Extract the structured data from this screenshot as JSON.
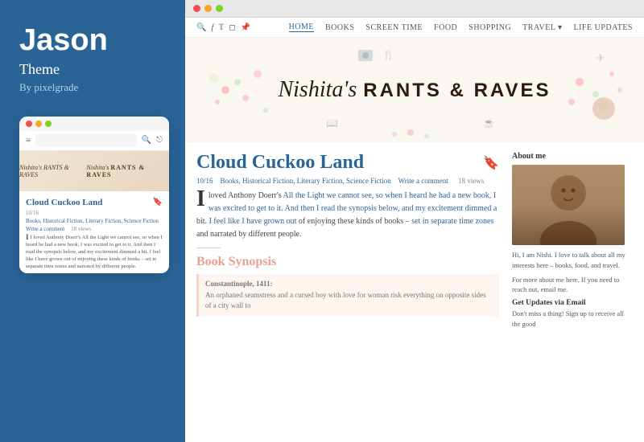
{
  "sidebar": {
    "theme_name": "Jason",
    "theme_label": "Theme",
    "by_label": "By pixelgrade",
    "dots": [
      "red",
      "yellow",
      "green"
    ],
    "mobile": {
      "toolbar_icons": [
        "≡",
        "🔍",
        "⎋"
      ],
      "blog_title": "Nishita's RANTS & RAVES",
      "article_title": "Cloud Cuckoo Land",
      "bookmark": "🔖",
      "meta": "10/16",
      "categories": "Books, Historical Fiction, Literary Fiction, Science Fiction",
      "write_comment": "Write a comment",
      "views": "18 views",
      "body_text": "I loved Anthony Doerr's All the Light we cannot see, so when I heard he had a new book, I was excited to get to it. And then I read the synopsis below, and my excitement dimmed a bit. I feel like I have grown out of enjoying these kinds of books – set in separate time zones and narrated by different people."
    }
  },
  "browser": {
    "dots": [
      "red",
      "yellow",
      "green"
    ],
    "nav": {
      "icons": [
        "🔍",
        "f",
        "𝕋",
        "📷",
        "📌"
      ],
      "links": [
        "HOME",
        "BOOKS",
        "SCREEN TIME",
        "FOOD",
        "SHOPPING",
        "TRAVEL",
        "LIFE UPDATES"
      ],
      "active": "HOME"
    },
    "blog_title_italic": "Nishita's",
    "blog_title_bold": "RANTS & RAVES",
    "article": {
      "title": "Cloud Cuckoo Land",
      "bookmark_icon": "🔖",
      "meta_date": "10/16",
      "meta_categories": "Books, Historical Fiction, Literary Fiction, Science Fiction",
      "meta_write_comment": "Write a comment",
      "meta_views": "18 views",
      "body": "I loved Anthony Doerr's All the Light we cannot see, so when I heard he had a new book, I was excited to get to it. And then I read the synopsis below, and my excitement dimmed a bit. I feel like I have grown out of enjoying these kinds of books – set in separate time zones and narrated by different people.",
      "highlighted_parts": [
        "All the Light we cannot see",
        "so when I heard he had a new book, I was excited to get to it. And then I read the synopsis below, and my excitement dimmed a",
        "I feel like I have grown out",
        "set in separate time zones"
      ],
      "synopsis_title": "Book Synopsis",
      "synopsis_location": "Constantinople, 1411:",
      "synopsis_text": "An orphaned seamstress and a cursed boy with love for woman risk everything on opposite sides of a city wall to"
    },
    "sidebar": {
      "about_title": "About me",
      "about_text": "Hi, I am Nishi. I love to talk about all my interests here – books, food, and travel.",
      "contact_text": "For more about me here. If you need to reach out, email me.",
      "updates_title": "Get Updates via Email",
      "updates_text": "Don't miss a thing! Sign up to receive all the good"
    }
  }
}
